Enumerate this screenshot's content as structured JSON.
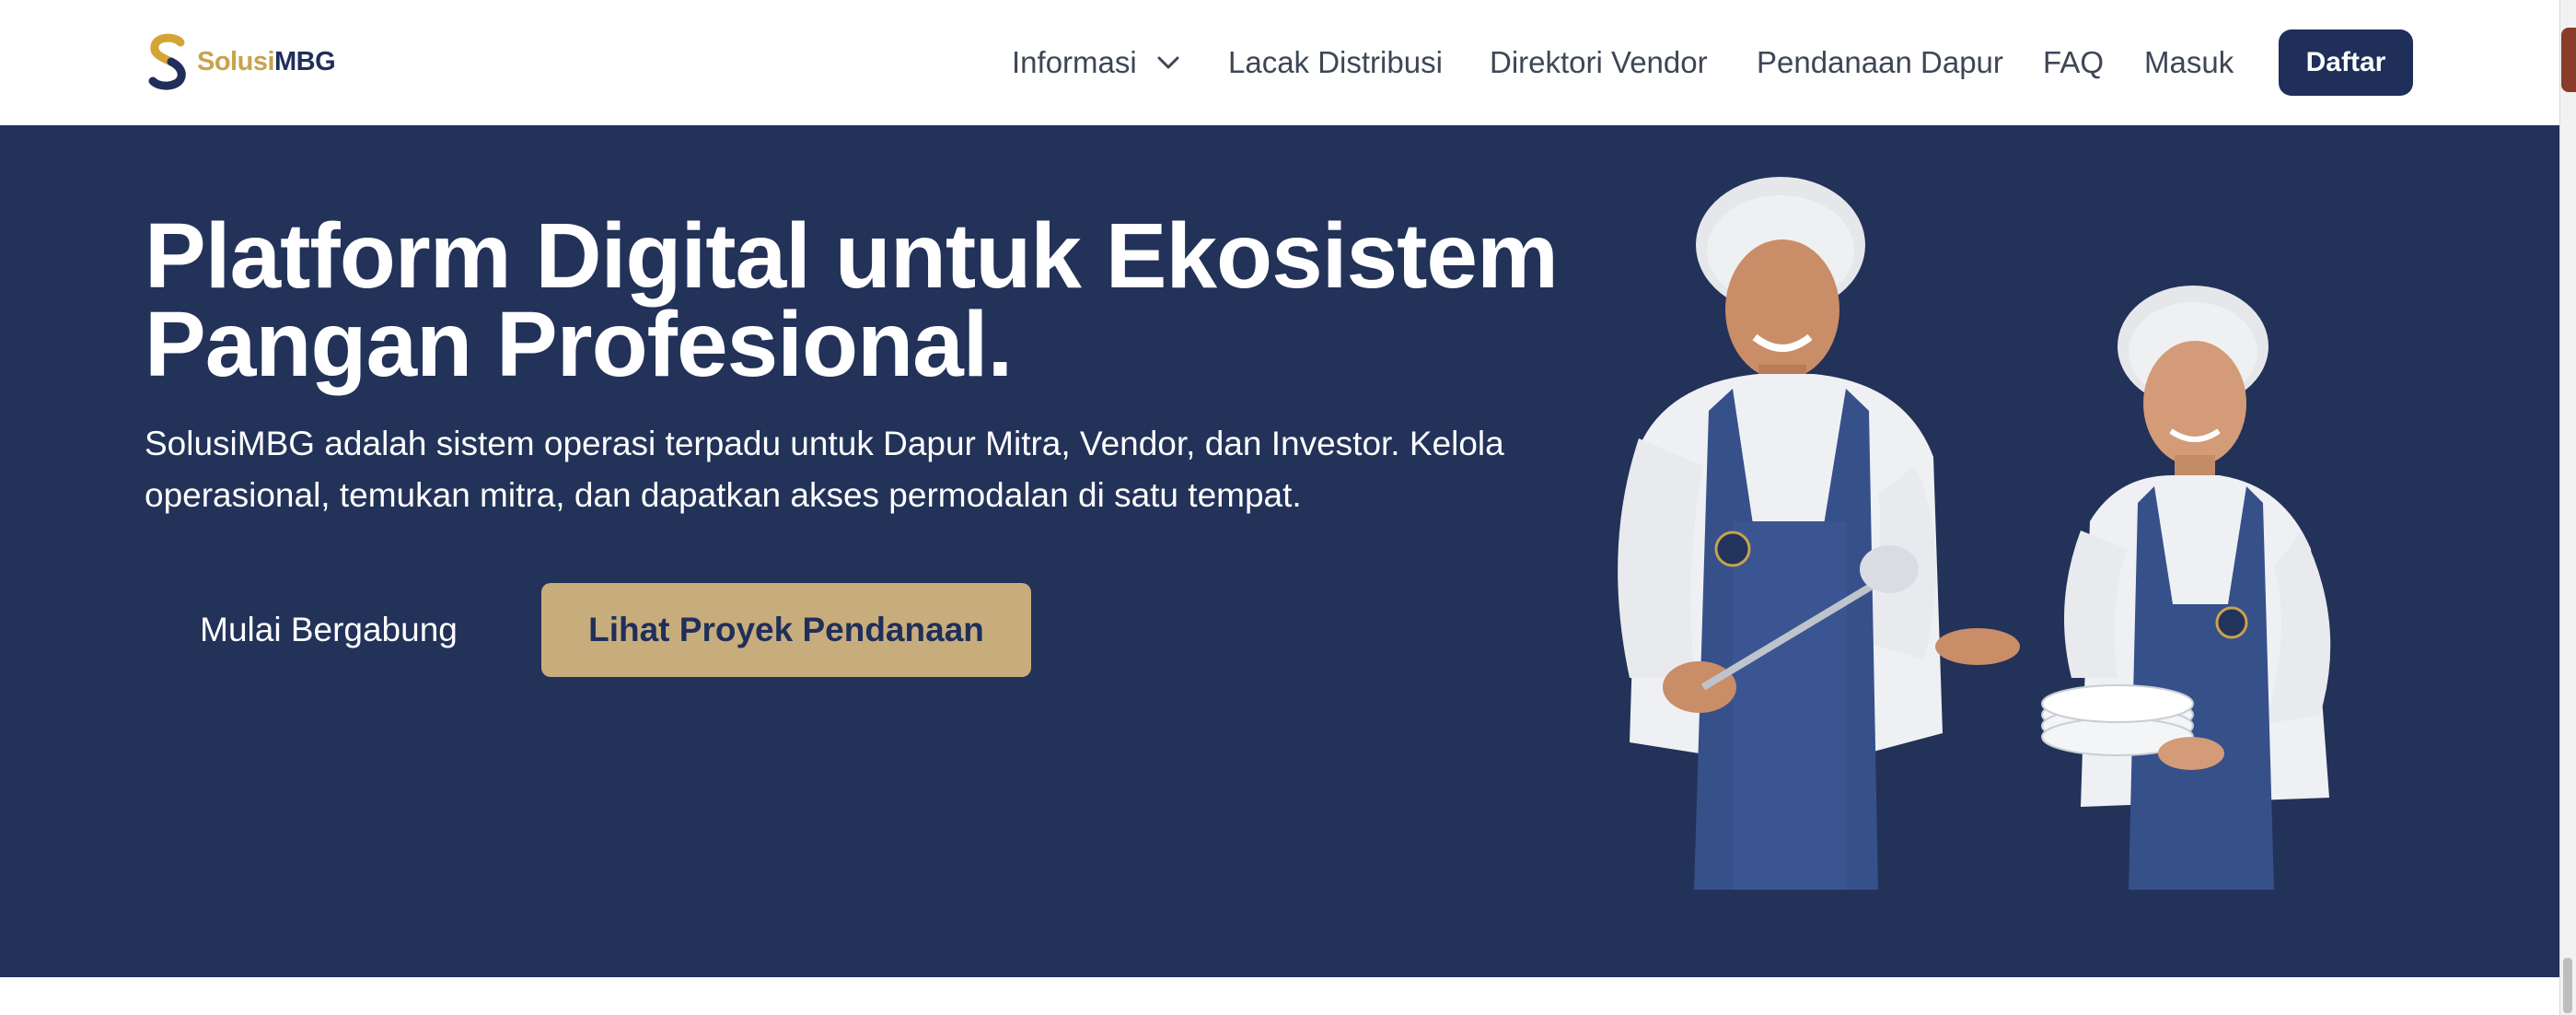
{
  "brand": {
    "name_part1": "Solusi",
    "name_part2": "MBG",
    "logo_icon": "s-logo-icon"
  },
  "nav": {
    "informasi": "Informasi",
    "lacak": "Lacak Distribusi",
    "direktori": "Direktori Vendor",
    "pendanaan": "Pendanaan Dapur",
    "faq": "FAQ",
    "masuk": "Masuk",
    "daftar": "Daftar"
  },
  "hero": {
    "title_line1": "Platform Digital untuk Ekosistem",
    "title_line2": "Pangan Profesional.",
    "description": "SolusiMBG adalah sistem operasi terpadu untuk Dapur Mitra, Vendor, dan Investor. Kelola operasional, temukan mitra, dan dapatkan akses permodalan di satu tempat.",
    "cta_primary": "Mulai Bergabung",
    "cta_secondary": "Lihat Proyek Pendanaan"
  },
  "colors": {
    "navy": "#223259",
    "gold": "#c8ad7c",
    "brand_gold": "#c9a24b",
    "brand_navy": "#1f2f5a"
  }
}
